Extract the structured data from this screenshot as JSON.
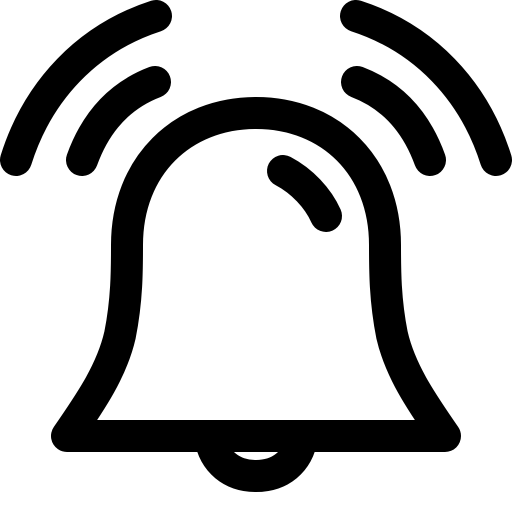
{
  "icon": {
    "name": "ringing-bell-icon",
    "stroke_color": "#000000",
    "fill_color": "#ffffff",
    "background_color": "#ffffff"
  }
}
